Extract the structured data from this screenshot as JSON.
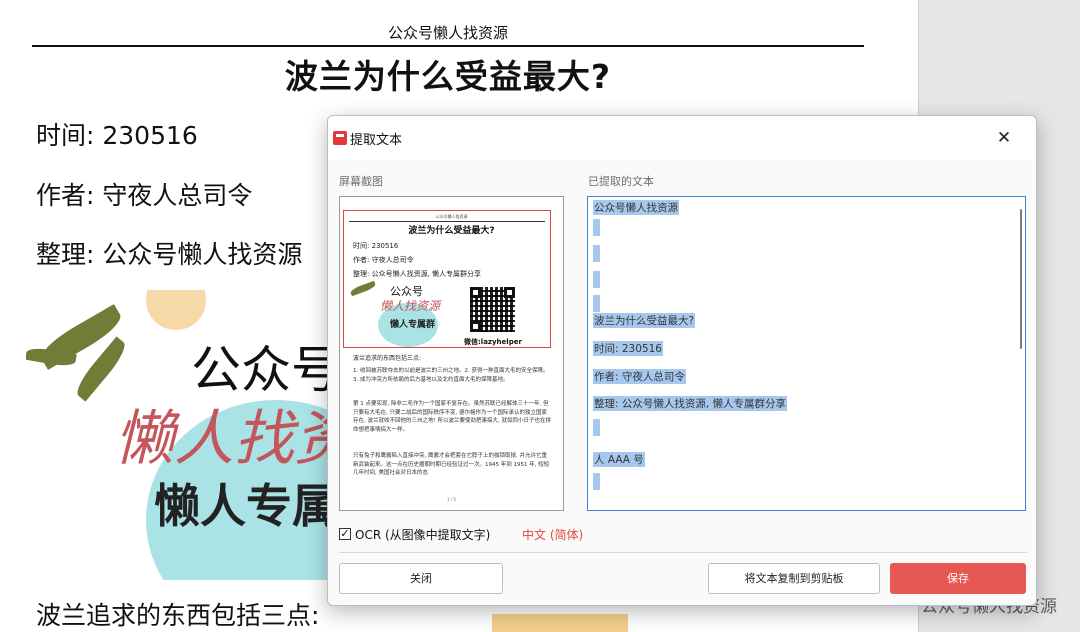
{
  "document": {
    "header": "公众号懒人找资源",
    "title": "波兰为什么受益最大?",
    "time_line": "时间: 230516",
    "author_line": "作者: 守夜人总司令",
    "editor_line": "整理: 公众号懒人找资源",
    "banner": {
      "line1": "公众号",
      "line2": "懒人找资源",
      "line3": "懒人专属群"
    },
    "bottom_line": "波兰追求的东西包括三点:"
  },
  "watermark": "公众号懒人找资源",
  "dialog": {
    "title": "提取文本",
    "close_symbol": "✕",
    "screenshot_label": "屏幕截图",
    "extracted_label": "已提取的文本",
    "thumbnail": {
      "header": "公众号懒人找资源",
      "title": "波兰为什么受益最大?",
      "time": "时间: 230516",
      "author": "作者: 守夜人总司令",
      "editor": "整理: 公众号懒人找资源, 懒人专属群分享",
      "banner_line1": "公众号",
      "banner_line2": "懒人找资源",
      "banner_line3": "懒人专属群",
      "wechat": "微信:lazyhelper",
      "section": "波兰追求的东西包括三点:",
      "para1": "1. 收回被苏联夺去的以前是波兰的三州之地。2. 获得一种直面大毛的安全保障。3. 成为冲突方所依赖的后方基地以及北约直面大毛的保障基地。",
      "para2": "第 1 点要实现, 除非二毛作为一个国家不复存在。虽然苏联已经解体三十一年, 但只要有大毛在, 只要二战后的国际秩序不变, 德尔格作为一个国际承认的独立国家存在, 波兰就收不回他的三州之地! 所以波兰要使劲把事搞大, 就如同小日子也在拼命想把事情搞大一样。",
      "para3": "只有兔子和鹰酱陷入直接冲突, 鹰酱才会把套在它脖子上的枷锁取掉, 并允许它重新武装起来。这一点在历史援朝时期已经验证过一次。1945 年到 1951 年, 短短几年时间, 美国社会对日本的态",
      "page": "1 / 5"
    },
    "extracted_text": {
      "line1": "公众号懒人找资源",
      "line2": "波兰为什么受益最大?",
      "line3": "时间: 230516",
      "line4": "作者: 守夜人总司令",
      "line5": "整理: 公众号懒人找资源, 懒人专属群分享",
      "line6": "人 AAA 号"
    },
    "ocr": {
      "checked": true,
      "check_symbol": "✓",
      "label": "OCR (从图像中提取文字)",
      "language": "中文 (简体)"
    },
    "buttons": {
      "close": "关闭",
      "copy": "将文本复制到剪贴板",
      "save": "保存"
    }
  },
  "colors": {
    "accent": "#e85853",
    "selection": "#a7c8ee",
    "focus_border": "#3b83d6",
    "language_link": "#e04a3a",
    "banner_circle": "#a9e3e6",
    "banner_red": "#c4555b"
  }
}
